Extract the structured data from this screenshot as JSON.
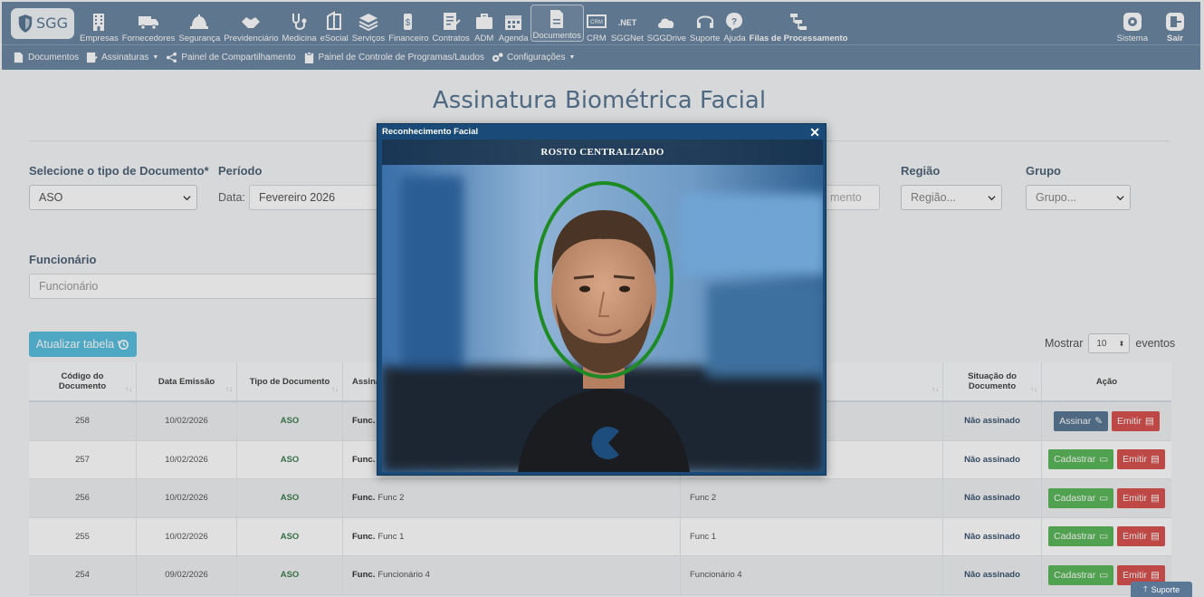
{
  "logo_text": "SGG",
  "nav": {
    "items": [
      {
        "label": "Empresas",
        "icon": "building-icon"
      },
      {
        "label": "Fornecedores",
        "icon": "truck-icon"
      },
      {
        "label": "Segurança",
        "icon": "hardhat-icon"
      },
      {
        "label": "Previdenciário",
        "icon": "handshake-icon"
      },
      {
        "label": "Medicina",
        "icon": "stethoscope-icon"
      },
      {
        "label": "eSocial",
        "icon": "esocial-icon"
      },
      {
        "label": "Serviços",
        "icon": "layers-icon"
      },
      {
        "label": "Financeiro",
        "icon": "money-icon"
      },
      {
        "label": "Contratos",
        "icon": "contract-icon"
      },
      {
        "label": "ADM",
        "icon": "briefcase-icon"
      },
      {
        "label": "Agenda",
        "icon": "calendar-icon"
      },
      {
        "label": "Documentos",
        "icon": "document-icon"
      },
      {
        "label": "CRM",
        "icon": "crm-icon"
      },
      {
        "label": "SGGNet",
        "icon": "net-icon"
      },
      {
        "label": "SGGDrive",
        "icon": "cloud-icon"
      },
      {
        "label": "Suporte",
        "icon": "headset-icon"
      },
      {
        "label": "Ajuda",
        "icon": "help-icon"
      },
      {
        "label": "Filas de Processamento",
        "icon": "queue-icon"
      }
    ],
    "sistema": "Sistema",
    "sair": "Sair"
  },
  "subnav": {
    "documentos": "Documentos",
    "assinaturas": "Assinaturas",
    "painel_compartilhamento": "Painel de Compartilhamento",
    "painel_controle": "Painel de Controle de Programas/Laudos",
    "configuracoes": "Configurações"
  },
  "page": {
    "title": "Assinatura Biométrica Facial",
    "tipo_label": "Selecione o tipo de Documento*",
    "tipo_value": "ASO",
    "periodo_label": "Período",
    "data_label": "Data:",
    "data_value": "Fevereiro 2026",
    "hidden_placeholder": "mento",
    "regiao_label": "Região",
    "regiao_value": "Região...",
    "grupo_label": "Grupo",
    "grupo_value": "Grupo...",
    "funcionario_label": "Funcionário",
    "funcionario_placeholder": "Funcionário",
    "atualizar": "Atualizar tabela",
    "mostrar": "Mostrar",
    "mostrar_value": "10",
    "eventos": "eventos"
  },
  "table": {
    "headers": {
      "codigo": "Código do Documento",
      "data": "Data Emissão",
      "tipo": "Tipo de Documento",
      "assina": "Assina",
      "situacao": "Situação do Documento",
      "acao": "Ação"
    },
    "rows": [
      {
        "codigo": "258",
        "data": "10/02/2026",
        "tipo": "ASO",
        "func_prefix": "Func.",
        "func": "",
        "func2": "",
        "situacao": "Não assinado",
        "btn1": "Assinar",
        "btn2": "Emitir"
      },
      {
        "codigo": "257",
        "data": "10/02/2026",
        "tipo": "ASO",
        "func_prefix": "Func.",
        "func": "",
        "func2": "",
        "situacao": "Não assinado",
        "btn1": "Cadastrar",
        "btn2": "Emitir"
      },
      {
        "codigo": "256",
        "data": "10/02/2026",
        "tipo": "ASO",
        "func_prefix": "Func.",
        "func": "Func 2",
        "func2": "Func 2",
        "situacao": "Não assinado",
        "btn1": "Cadastrar",
        "btn2": "Emitir"
      },
      {
        "codigo": "255",
        "data": "10/02/2026",
        "tipo": "ASO",
        "func_prefix": "Func.",
        "func": "Func 1",
        "func2": "Func 1",
        "situacao": "Não assinado",
        "btn1": "Cadastrar",
        "btn2": "Emitir"
      },
      {
        "codigo": "254",
        "data": "09/02/2026",
        "tipo": "ASO",
        "func_prefix": "Func.",
        "func": "Funcionário 4",
        "func2": "Funcionário 4",
        "situacao": "Não assinado",
        "btn1": "Cadastrar",
        "btn2": "Emitir"
      }
    ]
  },
  "modal": {
    "title": "Reconhecimento Facial",
    "close": "✕",
    "status": "ROSTO CENTRALIZADO",
    "face_frame_color": "#1e8a24"
  },
  "support_tab": "Suporte"
}
